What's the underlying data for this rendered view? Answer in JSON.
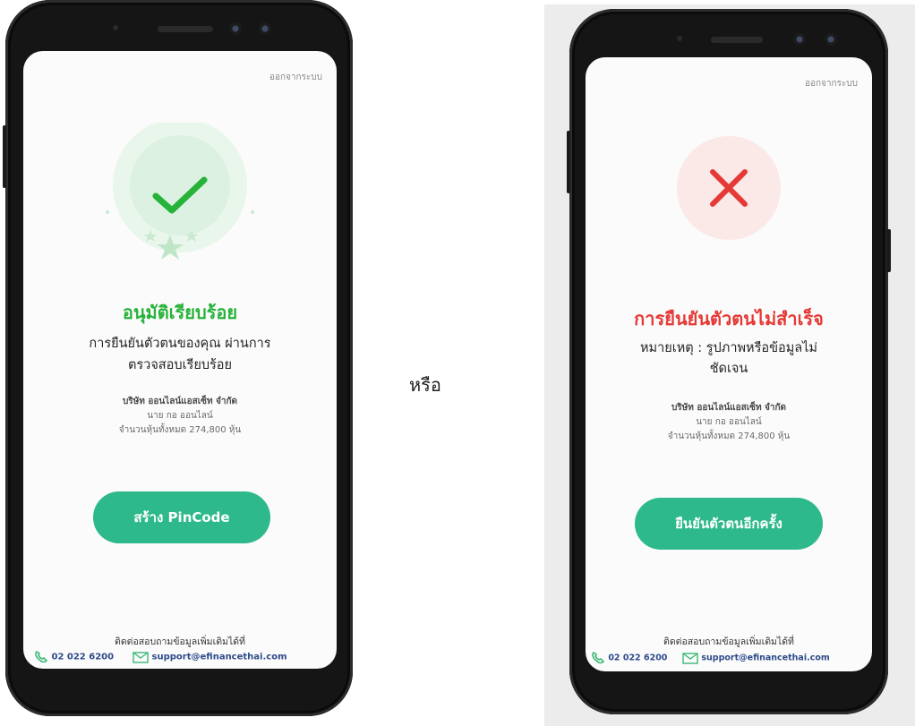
{
  "separator_label": "หรือ",
  "colors": {
    "approved_green": "#27b23a",
    "error_red": "#e53935",
    "button_teal": "#2db98b",
    "link_blue": "#2d4a8a"
  },
  "left_screen": {
    "logout_label": "ออกจากระบบ",
    "status_icon": "check-icon",
    "title": "อนุมัติเรียบร้อย",
    "subtitle_line1": "การยืนยันตัวตนของคุณ ผ่านการ",
    "subtitle_line2": "ตรวจสอบเรียบร้อย",
    "company": "บริษัท ออนไลน์แอสเซ็ท จำกัด",
    "holder": "นาย กอ ออนไลน์",
    "shares": "จำนวนหุ้นทั้งหมด 274,800 หุ้น",
    "button_label": "สร้าง PinCode",
    "contact_label": "ติดต่อสอบถามข้อมูลเพิ่มเติมได้ที่",
    "phone": "02 022 6200",
    "email": "support@efinancethai.com"
  },
  "right_screen": {
    "logout_label": "ออกจากระบบ",
    "status_icon": "close-icon",
    "title": "การยืนยันตัวตนไม่สำเร็จ",
    "subtitle_line1": "หมายเหตุ : รูปภาพหรือข้อมูลไม่",
    "subtitle_line2": "ชัดเจน",
    "company": "บริษัท ออนไลน์แอสเซ็ท จำกัด",
    "holder": "นาย กอ ออนไลน์",
    "shares": "จำนวนหุ้นทั้งหมด 274,800 หุ้น",
    "button_label": "ยืนยันตัวตนอีกครั้ง",
    "contact_label": "ติดต่อสอบถามข้อมูลเพิ่มเติมได้ที่",
    "phone": "02 022 6200",
    "email": "support@efinancethai.com"
  }
}
